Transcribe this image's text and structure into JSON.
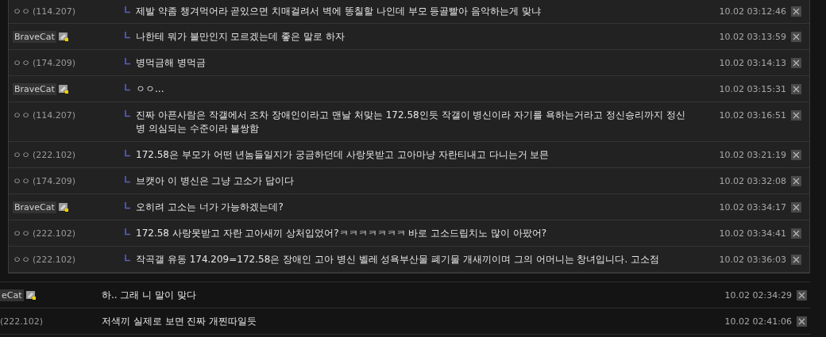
{
  "replies": [
    {
      "kind": "ip",
      "nick": "ㅇㅇ",
      "ip": "(114.207)",
      "text": "제발 약좀 챙겨먹어라 곧있으면 치매걸려서 벽에 똥칠할 나인데 부모 등골빨아 음악하는게 맞냐",
      "time": "10.02 03:12:46"
    },
    {
      "kind": "member",
      "nick": "BraveCat",
      "text": "나한테 뭐가 불만인지 모르겠는데 좋은 말로 하자",
      "time": "10.02 03:13:59"
    },
    {
      "kind": "ip",
      "nick": "ㅇㅇ",
      "ip": "(174.209)",
      "text": "병먹금해 병먹금",
      "time": "10.02 03:14:13"
    },
    {
      "kind": "member",
      "nick": "BraveCat",
      "text": "ㅇㅇ...",
      "time": "10.02 03:15:31"
    },
    {
      "kind": "ip",
      "nick": "ㅇㅇ",
      "ip": "(114.207)",
      "text": "진짜 아픈사람은 작갤에서 조차 장애인이라고 맨날 처맞는 172.58인듯 작갤이 병신이라 자기를 욕하는거라고 정신승리까지 정신병 의심되는 수준이라 불쌍함",
      "time": "10.02 03:16:51"
    },
    {
      "kind": "ip",
      "nick": "ㅇㅇ",
      "ip": "(222.102)",
      "text": "172.58은 부모가 어떤 년놈들일지가 궁금하던데 사랑못받고 고아마냥 자란티내고 다니는거 보믄",
      "time": "10.02 03:21:19"
    },
    {
      "kind": "ip",
      "nick": "ㅇㅇ",
      "ip": "(174.209)",
      "text": "브캣아 이 병신은 그냥 고소가 답이다",
      "time": "10.02 03:32:08"
    },
    {
      "kind": "member",
      "nick": "BraveCat",
      "text": "오히려 고소는 너가 가능하겠는데?",
      "time": "10.02 03:34:17"
    },
    {
      "kind": "ip",
      "nick": "ㅇㅇ",
      "ip": "(222.102)",
      "text": "172.58 사랑못받고 자란 고아새끼 상처입었어?ㅋㅋㅋㅋㅋㅋㅋ 바로 고소드립치노 많이 아팠어?",
      "time": "10.02 03:34:41"
    },
    {
      "kind": "ip",
      "nick": "ㅇㅇ",
      "ip": "(222.102)",
      "text": "작곡갤 유동 174.209=172.58은 장애인 고아 병신 벨레 성욕부산물 폐기물 개새끼이며 그의 어머니는 창녀입니다. 고소점",
      "time": "10.02 03:36:03"
    }
  ],
  "comments": [
    {
      "kind": "member",
      "nick": "eCat",
      "text": "하.. 그래 니 말이 맞다",
      "time": "10.02 02:34:29"
    },
    {
      "kind": "ip",
      "ip": "(222.102)",
      "text": "저색끼 실제로 보면 진짜 개찐따일듯",
      "time": "10.02 02:41:06"
    }
  ]
}
